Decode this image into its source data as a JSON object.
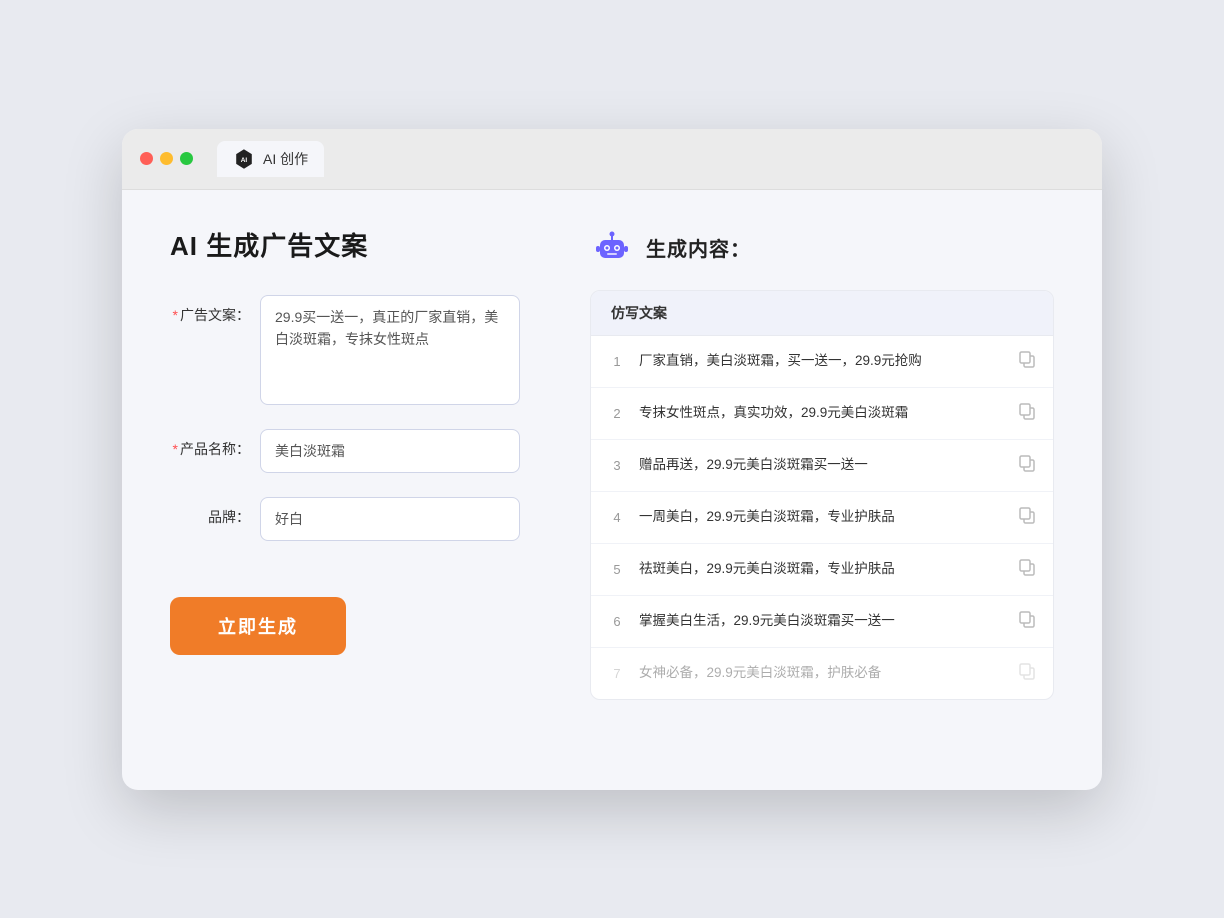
{
  "browser": {
    "tab_label": "AI 创作"
  },
  "page": {
    "title": "AI 生成广告文案",
    "form": {
      "ad_copy_label": "广告文案：",
      "ad_copy_required": "*",
      "ad_copy_value": "29.9买一送一，真正的厂家直销，美白淡斑霜，专抹女性斑点",
      "product_name_label": "产品名称：",
      "product_name_required": "*",
      "product_name_value": "美白淡斑霜",
      "brand_label": "品牌：",
      "brand_value": "好白",
      "generate_button": "立即生成"
    },
    "result": {
      "header_icon": "robot-icon",
      "header_title": "生成内容：",
      "table_header": "仿写文案",
      "rows": [
        {
          "num": "1",
          "text": "厂家直销，美白淡斑霜，买一送一，29.9元抢购",
          "faded": false
        },
        {
          "num": "2",
          "text": "专抹女性斑点，真实功效，29.9元美白淡斑霜",
          "faded": false
        },
        {
          "num": "3",
          "text": "赠品再送，29.9元美白淡斑霜买一送一",
          "faded": false
        },
        {
          "num": "4",
          "text": "一周美白，29.9元美白淡斑霜，专业护肤品",
          "faded": false
        },
        {
          "num": "5",
          "text": "祛斑美白，29.9元美白淡斑霜，专业护肤品",
          "faded": false
        },
        {
          "num": "6",
          "text": "掌握美白生活，29.9元美白淡斑霜买一送一",
          "faded": false
        },
        {
          "num": "7",
          "text": "女神必备，29.9元美白淡斑霜，护肤必备",
          "faded": true
        }
      ]
    }
  },
  "colors": {
    "primary_orange": "#f07c28",
    "required_red": "#ff4d4f",
    "accent_purple": "#7b8cde"
  }
}
